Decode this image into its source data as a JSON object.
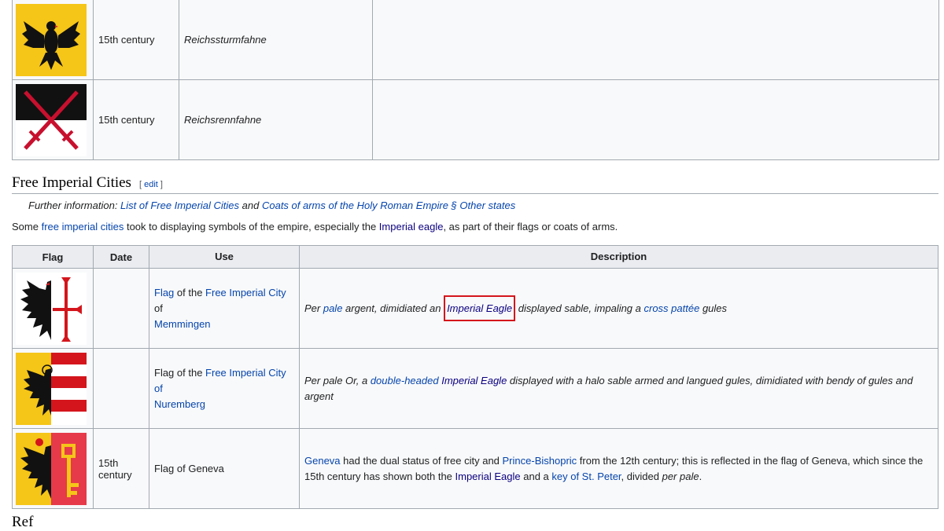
{
  "top_table": {
    "rows": [
      {
        "date": "15th century",
        "use": "Reichssturmfahne",
        "flag_icon": "reichssturmfahne-flag"
      },
      {
        "date": "15th century",
        "use": "Reichsrennfahne",
        "flag_icon": "reichsrennfahne-flag"
      }
    ]
  },
  "section": {
    "title": "Free Imperial Cities",
    "edit_open": "[ ",
    "edit": "edit",
    "edit_close": " ]"
  },
  "hatnote": {
    "prefix": "Further information: ",
    "link1": "List of Free Imperial Cities",
    "and": " and ",
    "link2": "Coats of arms of the Holy Roman Empire § Other states"
  },
  "intro": {
    "t1": "Some ",
    "link1": "free imperial cities",
    "t2": " took to displaying symbols of the empire, especially the ",
    "link2": "Imperial eagle",
    "t3": ", as part of their flags or coats of arms."
  },
  "cities_table": {
    "headers": [
      "Flag",
      "Date",
      "Use",
      "Description"
    ],
    "row1": {
      "flag_icon": "memmingen-flag",
      "date": "",
      "use_link1": "Flag",
      "use_t1": " of the ",
      "use_link2": "Free Imperial City",
      "use_t2": " of ",
      "use_link3": "Memmingen",
      "d_t1": "Per ",
      "d_link1": "pale",
      "d_t2": " argent, dimidiated an ",
      "d_link2": "Imperial Eagle",
      "d_t3": " displayed sable, impaling a ",
      "d_link3": "cross pattée",
      "d_t4": " gules"
    },
    "row2": {
      "flag_icon": "nuremberg-flag",
      "date": "",
      "use_t1": "Flag of the ",
      "use_link1": "Free Imperial City of",
      "use_link2": "Nuremberg",
      "d_t1": "Per pale Or, a ",
      "d_link1": "double-headed",
      "d_link2": "Imperial Eagle",
      "d_t2": " displayed with a halo sable armed and langued gules, dimidiated with bendy of gules and argent"
    },
    "row3": {
      "flag_icon": "geneva-flag",
      "date_line1": "15th",
      "date_line2": "century",
      "use": "Flag of Geneva",
      "d_link1": "Geneva",
      "d_t1": " had the dual status of free city and ",
      "d_link2": "Prince-Bishopric",
      "d_t2": " from the 12th century; this is reflected in the flag of Geneva, which since the 15th century has shown both the ",
      "d_link3": "Imperial Eagle",
      "d_t3": " and a ",
      "d_link4": "key of St. Peter",
      "d_t4": ", divided ",
      "d_italic": "per pale",
      "d_t5": "."
    }
  },
  "references_heading": "Ref",
  "colors": {
    "link": "#0645ad",
    "visited_link": "#0b0080",
    "highlight": "#d4151c",
    "table_bg": "#f8f9fa",
    "border": "#a2a9b1"
  }
}
